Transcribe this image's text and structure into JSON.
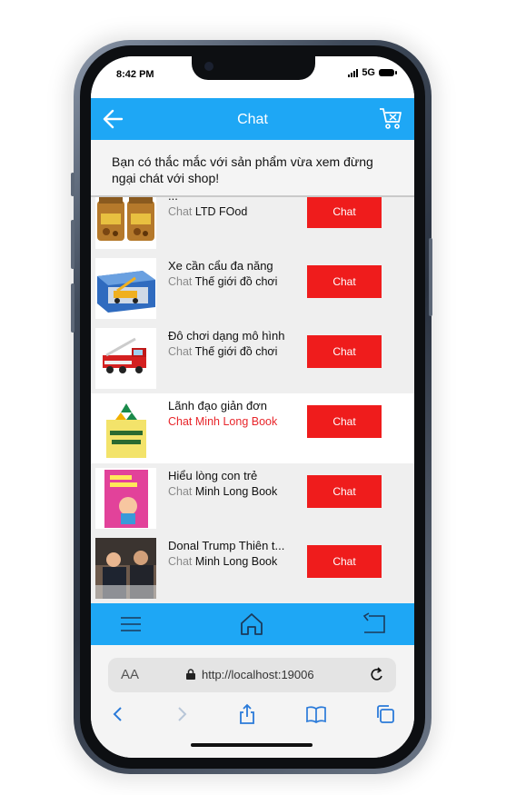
{
  "status_bar": {
    "time": "8:42 PM",
    "network": "5G"
  },
  "app_bar": {
    "title": "Chat",
    "back_icon": "arrow-left-icon",
    "cart_icon": "cart-icon"
  },
  "notice": {
    "text": "Bạn có thắc mắc với sản phẩm vừa xem đừng ngại chát với shop!"
  },
  "chat_label": "Chat",
  "products": [
    {
      "name": "...",
      "shop": "LTD FOod",
      "image": "dried-snack-jars",
      "selected": false
    },
    {
      "name": "Xe cần cẩu đa năng",
      "shop": "Thế giới đồ chơi",
      "image": "toy-crane-box",
      "selected": false
    },
    {
      "name": "Đô chơi dạng mô hình",
      "shop": "Thế giới đồ chơi",
      "image": "toy-fire-truck",
      "selected": false
    },
    {
      "name": "Lãnh đạo giản đơn",
      "shop": "Minh Long Book",
      "image": "book-lanh-dao",
      "selected": true
    },
    {
      "name": "Hiểu lòng con trẻ",
      "shop": "Minh Long Book",
      "image": "book-hieu-long",
      "selected": false
    },
    {
      "name": "Donal Trump Thiên t...",
      "shop": "Minh Long Book",
      "image": "trump-photo",
      "selected": false
    }
  ],
  "bottom_nav": [
    {
      "icon": "menu-icon"
    },
    {
      "icon": "home-icon"
    },
    {
      "icon": "return-icon"
    }
  ],
  "browser": {
    "text_size_label": "AA",
    "url": "http://localhost:19006",
    "tools": [
      "back-icon",
      "forward-icon",
      "share-icon",
      "bookmarks-icon",
      "tabs-icon"
    ]
  },
  "colors": {
    "primary": "#1ea7f5",
    "chat_button": "#ef1c1c",
    "selected_shop": "#e8262b"
  }
}
